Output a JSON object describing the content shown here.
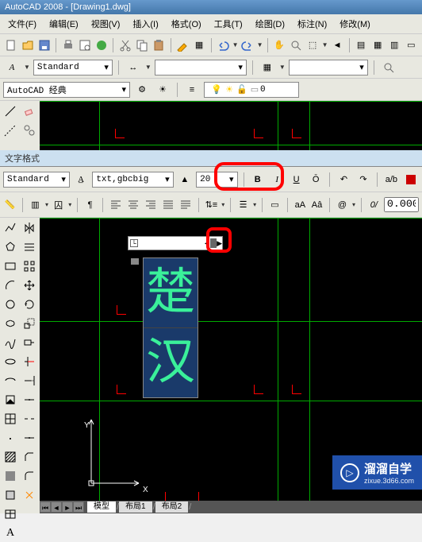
{
  "title": "AutoCAD 2008 - [Drawing1.dwg]",
  "menu": {
    "file": "文件(F)",
    "edit": "编辑(E)",
    "view": "视图(V)",
    "insert": "插入(I)",
    "format": "格式(O)",
    "tools": "工具(T)",
    "draw": "绘图(D)",
    "dimension": "标注(N)",
    "modify": "修改(M)"
  },
  "style": {
    "text_style": "Standard",
    "workspace": "AutoCAD 经典",
    "layer_name": "0"
  },
  "section_label": "文字格式",
  "text_format": {
    "style": "Standard",
    "font": "txt,gbcbig",
    "size": "20",
    "width_factor": "0.000"
  },
  "editor": {
    "char1": "楚",
    "char2": "汉"
  },
  "axes": {
    "x": "X",
    "y": "Y"
  },
  "tabs": {
    "model": "模型",
    "layout1": "布局1",
    "layout2": "布局2"
  },
  "watermark": {
    "brand": "溜溜自学",
    "url": "zixue.3d66.com"
  },
  "icons": {
    "bold": "B",
    "italic": "I",
    "underline": "U",
    "overline": "Ō",
    "symbol": "@",
    "field": "0/",
    "aa": "aA",
    "a_caret": "Aâ"
  }
}
